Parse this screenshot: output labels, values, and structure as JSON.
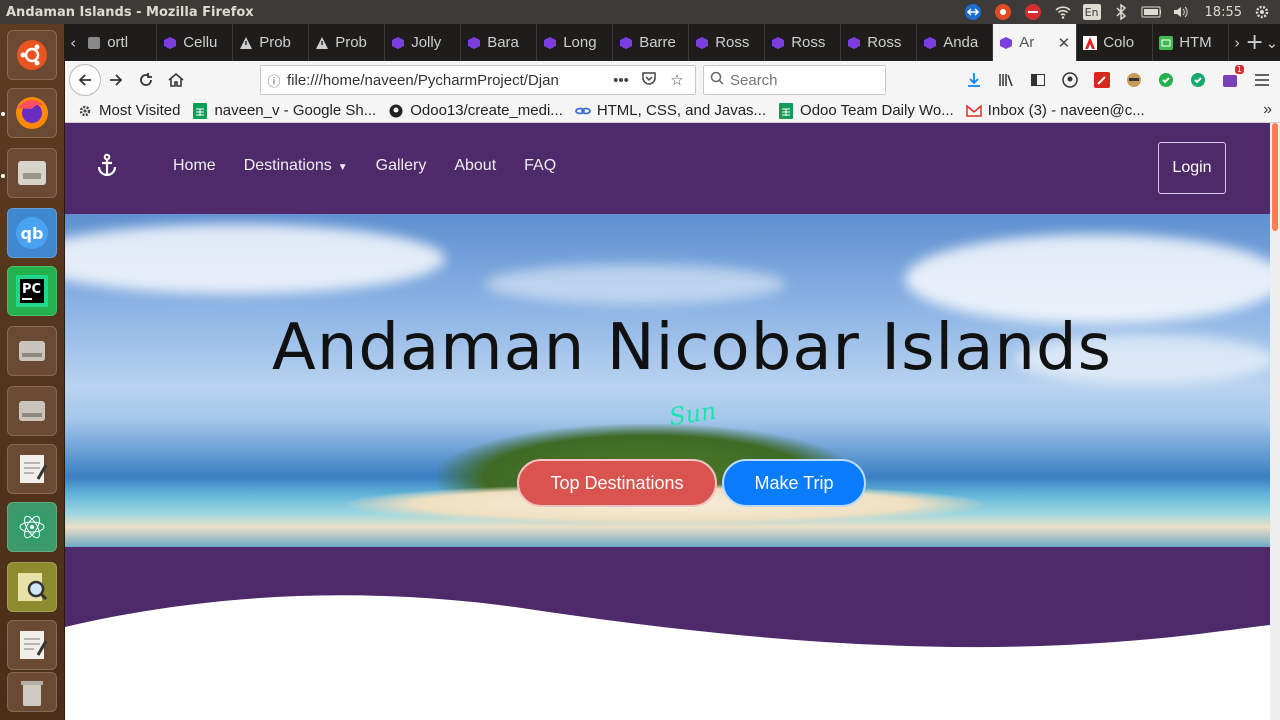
{
  "os": {
    "window_title": "Andaman Islands - Mozilla Firefox",
    "keyboard_layout": "En",
    "clock": "18:55"
  },
  "browser": {
    "tabs": [
      {
        "label": "ortl",
        "icon": "generic-tab-icon"
      },
      {
        "label": "Cellu",
        "icon": "purple-cube-icon"
      },
      {
        "label": "Prob",
        "icon": "warning-icon"
      },
      {
        "label": "Prob",
        "icon": "warning-icon"
      },
      {
        "label": "Jolly",
        "icon": "purple-cube-icon"
      },
      {
        "label": "Bara",
        "icon": "purple-cube-icon"
      },
      {
        "label": "Long",
        "icon": "purple-cube-icon"
      },
      {
        "label": "Barre",
        "icon": "purple-cube-icon"
      },
      {
        "label": "Ross",
        "icon": "purple-cube-icon"
      },
      {
        "label": "Ross",
        "icon": "purple-cube-icon"
      },
      {
        "label": "Ross",
        "icon": "purple-cube-icon"
      },
      {
        "label": "Anda",
        "icon": "purple-cube-icon"
      },
      {
        "label": "Ar",
        "icon": "purple-cube-icon",
        "active": true
      },
      {
        "label": "Colo",
        "icon": "adobe-icon"
      },
      {
        "label": "HTM",
        "icon": "html-icon"
      }
    ],
    "url": "file:///home/naveen/PycharmProject/Djan",
    "search_placeholder": "Search",
    "bookmarks": [
      {
        "label": "Most Visited",
        "icon": "gear-icon"
      },
      {
        "label": "naveen_v - Google Sh...",
        "icon": "sheets-icon"
      },
      {
        "label": "Odoo13/create_medi...",
        "icon": "github-icon"
      },
      {
        "label": "HTML, CSS, and Javas...",
        "icon": "link-icon"
      },
      {
        "label": "Odoo Team Daily Wo...",
        "icon": "sheets-icon"
      },
      {
        "label": "Inbox (3) - naveen@c...",
        "icon": "gmail-icon"
      }
    ],
    "notification_badge": "1"
  },
  "site": {
    "nav": {
      "brand_icon": "anchor-icon",
      "links": [
        "Home",
        "Destinations",
        "Gallery",
        "About",
        "FAQ"
      ],
      "login_label": "Login"
    },
    "hero": {
      "title": "Andaman Nicobar Islands",
      "signature": "Sun",
      "primary_button": "Top Destinations",
      "secondary_button": "Make Trip"
    },
    "colors": {
      "nav_bg": "#4f2a6b",
      "btn_primary": "#d9534f",
      "btn_secondary": "#0a7cff"
    }
  }
}
